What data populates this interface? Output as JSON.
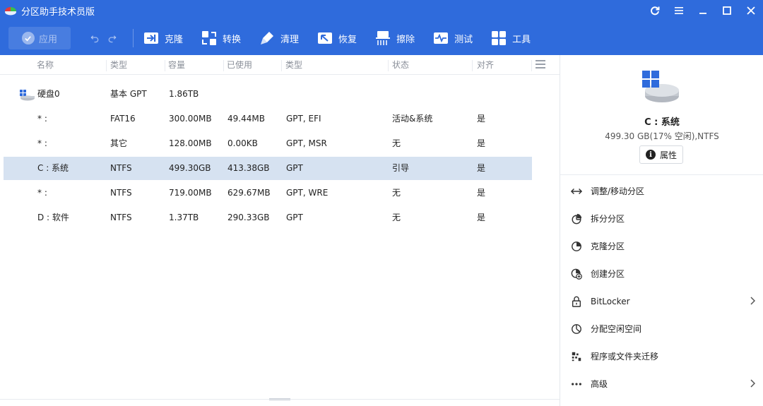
{
  "window": {
    "title": "分区助手技术员版"
  },
  "toolbar": {
    "apply_label": "应用",
    "tools": [
      {
        "label": "克隆",
        "icon": "clone-icon"
      },
      {
        "label": "转换",
        "icon": "convert-icon"
      },
      {
        "label": "清理",
        "icon": "clean-icon"
      },
      {
        "label": "恢复",
        "icon": "recover-icon"
      },
      {
        "label": "擦除",
        "icon": "wipe-icon"
      },
      {
        "label": "测试",
        "icon": "test-icon"
      },
      {
        "label": "工具",
        "icon": "tools-icon"
      }
    ]
  },
  "table": {
    "headers": [
      "名称",
      "类型",
      "容量",
      "已使用",
      "类型",
      "状态",
      "对齐"
    ],
    "disk": {
      "name": "硬盘0",
      "type": "基本 GPT",
      "capacity": "1.86TB"
    },
    "rows": [
      {
        "name": "* :",
        "fs": "FAT16",
        "capacity": "300.00MB",
        "used": "49.44MB",
        "type": "GPT, EFI",
        "status": "活动&系统",
        "align": "是"
      },
      {
        "name": "* :",
        "fs": "其它",
        "capacity": "128.00MB",
        "used": "0.00KB",
        "type": "GPT, MSR",
        "status": "无",
        "align": "是"
      },
      {
        "name": "C : 系统",
        "fs": "NTFS",
        "capacity": "499.30GB",
        "used": "413.38GB",
        "type": "GPT",
        "status": "引导",
        "align": "是"
      },
      {
        "name": "* :",
        "fs": "NTFS",
        "capacity": "719.00MB",
        "used": "629.67MB",
        "type": "GPT, WRE",
        "status": "无",
        "align": "是"
      },
      {
        "name": "D : 软件",
        "fs": "NTFS",
        "capacity": "1.37TB",
        "used": "290.33GB",
        "type": "GPT",
        "status": "无",
        "align": "是"
      }
    ]
  },
  "side": {
    "title": "C : 系统",
    "subtitle": "499.30 GB(17% 空闲),NTFS",
    "properties_label": "属性",
    "operations": [
      {
        "label": "调整/移动分区",
        "icon": "resize-icon",
        "submenu": false
      },
      {
        "label": "拆分分区",
        "icon": "split-icon",
        "submenu": false
      },
      {
        "label": "克隆分区",
        "icon": "clone-partition-icon",
        "submenu": false
      },
      {
        "label": "创建分区",
        "icon": "create-partition-icon",
        "submenu": false
      },
      {
        "label": "BitLocker",
        "icon": "lock-icon",
        "submenu": true
      },
      {
        "label": "分配空闲空间",
        "icon": "allocate-space-icon",
        "submenu": false
      },
      {
        "label": "程序或文件夹迁移",
        "icon": "migrate-icon",
        "submenu": false
      },
      {
        "label": "高级",
        "icon": "more-icon",
        "submenu": true
      }
    ]
  },
  "colors": {
    "primary": "#2f6bdc",
    "selected_row": "#d6e2f1"
  }
}
